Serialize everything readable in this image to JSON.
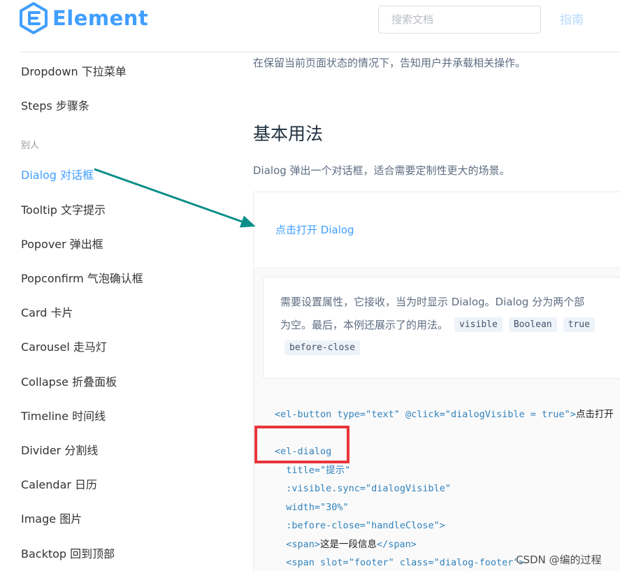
{
  "header": {
    "logo_text": "Element",
    "search_placeholder": "搜索文档",
    "nav_guide": "指南"
  },
  "sidebar": {
    "items_top": [
      "Dropdown 下拉菜单",
      "Steps 步骤条"
    ],
    "group_label": "别人",
    "items": [
      "Dialog 对话框",
      "Tooltip 文字提示",
      "Popover 弹出框",
      "Popconfirm 气泡确认框",
      "Card 卡片",
      "Carousel 走马灯",
      "Collapse 折叠面板",
      "Timeline 时间线",
      "Divider 分割线",
      "Calendar 日历",
      "Image 图片",
      "Backtop 回到顶部"
    ],
    "active_item": "Dialog 对话框"
  },
  "main": {
    "intro": "在保留当前页面状态的情况下，告知用户并承载相关操作。",
    "section_title": "基本用法",
    "section_desc": "Dialog 弹出一个对话框，适合需要定制性更大的场景。",
    "open_button": "点击打开 Dialog",
    "description_line1": "需要设置属性，它接收，当为时显示 Dialog。Dialog 分为两个部",
    "description_line2": "为空。最后，本例还展示了的用法。",
    "tags": [
      "visible",
      "Boolean",
      "true",
      "before-close"
    ]
  },
  "code": {
    "line1_tag": "<el-button",
    "line1_attr1": " type=",
    "line1_str1": "\"text\"",
    "line1_attr2": " @click=",
    "line1_str2": "\"dialogVisible = true\"",
    "line1_close": ">",
    "line1_text": "点击打开",
    "line2": "<el-dialog",
    "line3_attr": "  title=",
    "line3_str": "\"提示\"",
    "line4_attr": "  :visible.sync=",
    "line4_str": "\"dialogVisible\"",
    "line5_attr": "  width=",
    "line5_str": "\"30%\"",
    "line6_attr": "  :before-close=",
    "line6_str": "\"handleClose\"",
    "line6_close": ">",
    "line7_open": "  <span>",
    "line7_text": "这是一段信息",
    "line7_close": "</span>",
    "line8_tag": "  <span",
    "line8_attr1": " slot=",
    "line8_str1": "\"footer\"",
    "line8_attr2": " class=",
    "line8_str2": "\"dialog-footer\"",
    "line8_close": ">"
  },
  "watermark": "CSDN @编的过程",
  "colors": {
    "brand": "#409eff",
    "annotation_box": "#e8353a",
    "annotation_arrow": "#0a8f8a"
  }
}
